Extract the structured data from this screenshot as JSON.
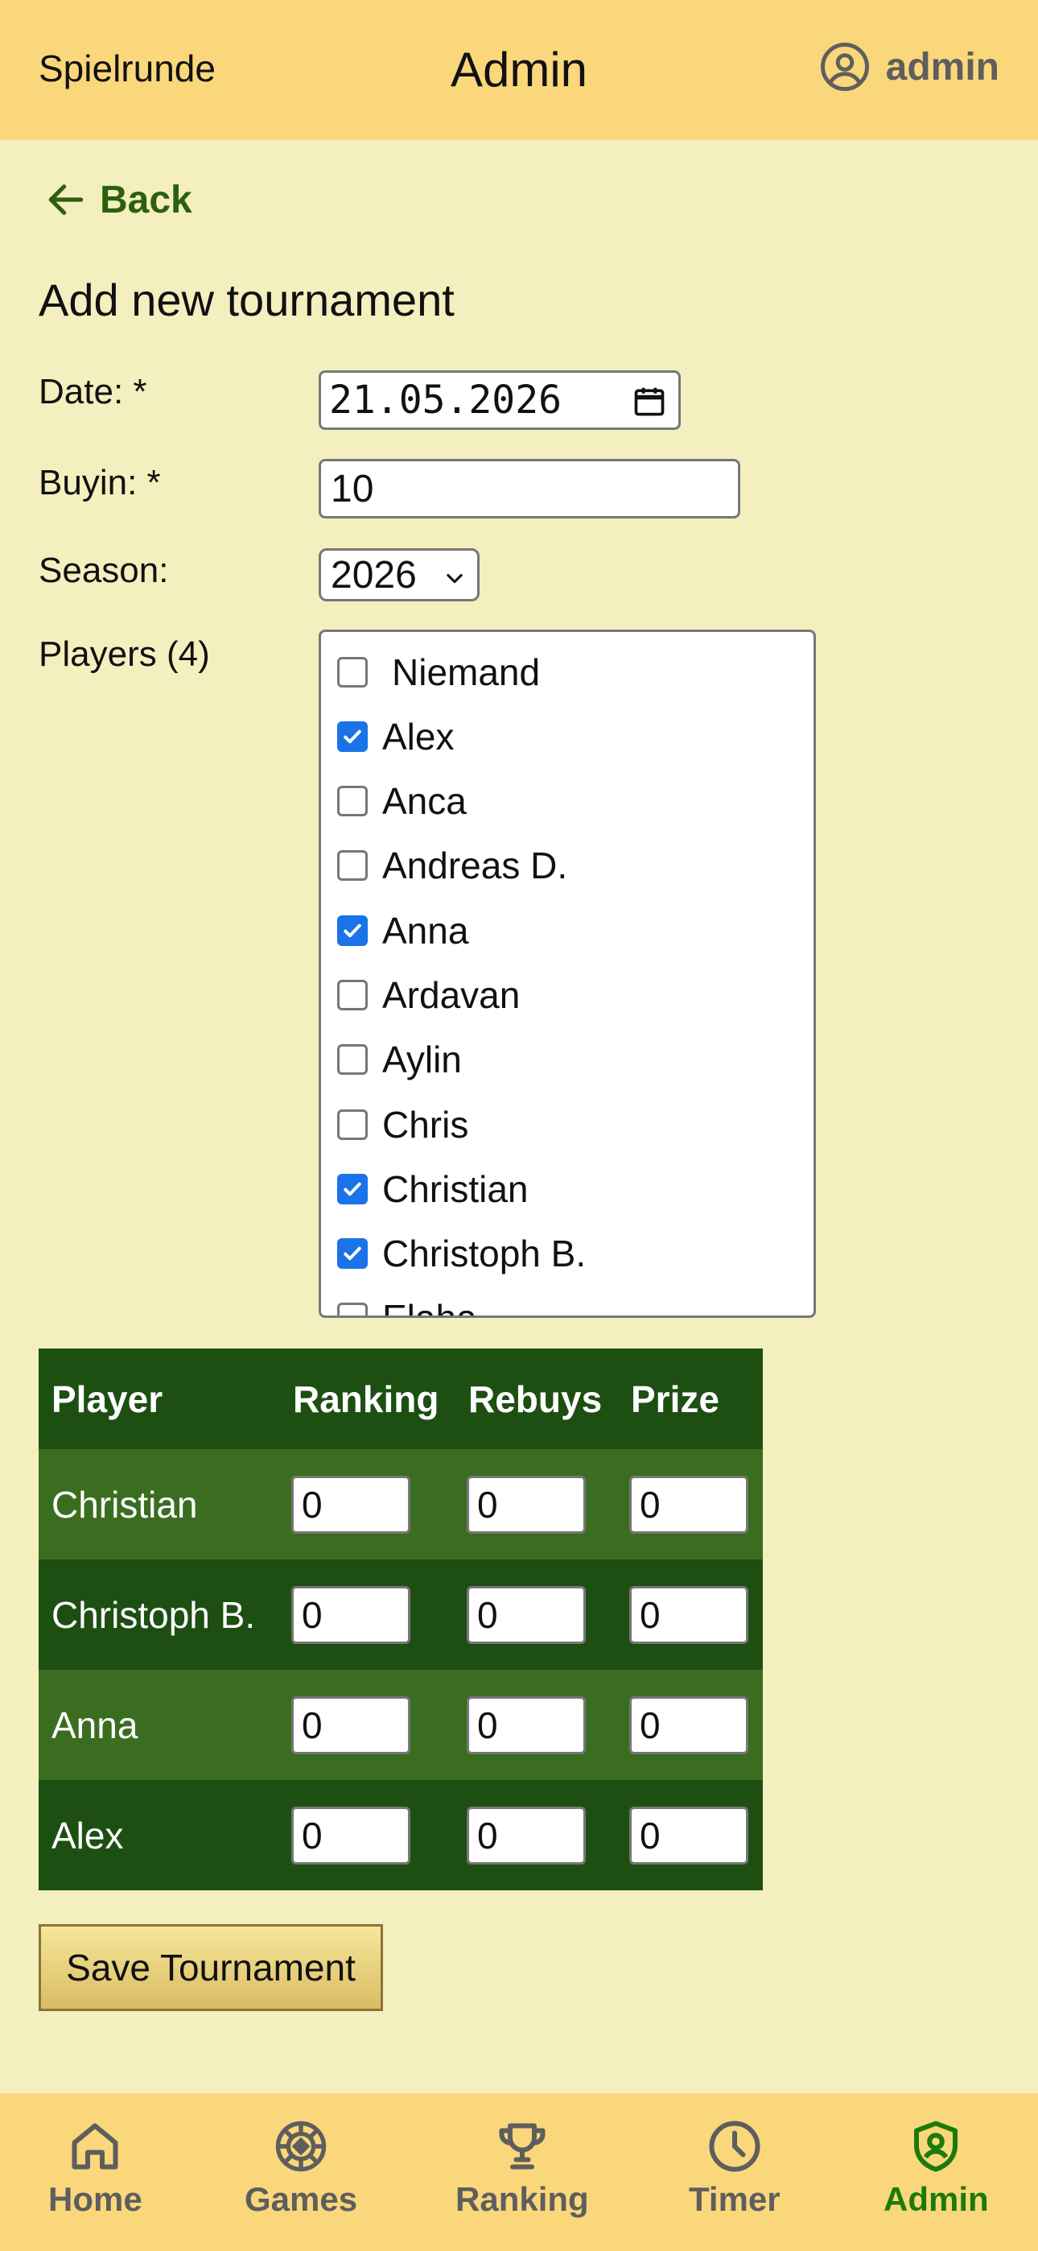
{
  "header": {
    "brand": "Spielrunde",
    "title": "Admin",
    "user_name": "admin"
  },
  "back_label": "Back",
  "page_title": "Add new tournament",
  "form": {
    "date_label": "Date: *",
    "date_value": "21.05.2026",
    "buyin_label": "Buyin: *",
    "buyin_value": "10",
    "season_label": "Season:",
    "season_value": "2026",
    "players_label": "Players (4)"
  },
  "players": [
    {
      "name": "Niemand",
      "checked": false
    },
    {
      "name": "Alex",
      "checked": true
    },
    {
      "name": "Anca",
      "checked": false
    },
    {
      "name": "Andreas D.",
      "checked": false
    },
    {
      "name": "Anna",
      "checked": true
    },
    {
      "name": "Ardavan",
      "checked": false
    },
    {
      "name": "Aylin",
      "checked": false
    },
    {
      "name": "Chris",
      "checked": false
    },
    {
      "name": "Christian",
      "checked": true
    },
    {
      "name": "Christoph B.",
      "checked": true
    },
    {
      "name": "Elaha",
      "checked": false
    }
  ],
  "table": {
    "headers": [
      "Player",
      "Ranking",
      "Rebuys",
      "Prize"
    ],
    "rows": [
      {
        "player": "Christian",
        "ranking": "0",
        "rebuys": "0",
        "prize": "0"
      },
      {
        "player": "Christoph B.",
        "ranking": "0",
        "rebuys": "0",
        "prize": "0"
      },
      {
        "player": "Anna",
        "ranking": "0",
        "rebuys": "0",
        "prize": "0"
      },
      {
        "player": "Alex",
        "ranking": "0",
        "rebuys": "0",
        "prize": "0"
      }
    ]
  },
  "save_label": "Save Tournament",
  "nav": [
    {
      "label": "Home",
      "icon": "home-icon",
      "active": false
    },
    {
      "label": "Games",
      "icon": "chip-icon",
      "active": false
    },
    {
      "label": "Ranking",
      "icon": "trophy-icon",
      "active": false
    },
    {
      "label": "Timer",
      "icon": "clock-icon",
      "active": false
    },
    {
      "label": "Admin",
      "icon": "shield-user-icon",
      "active": true
    }
  ],
  "colors": {
    "header_bg": "#fad77b",
    "page_bg": "#f3efbf",
    "accent_green": "#1c7a0a",
    "table_dark": "#1d4f13",
    "table_light": "#3b6d21",
    "checkbox_blue": "#1a73e8"
  }
}
